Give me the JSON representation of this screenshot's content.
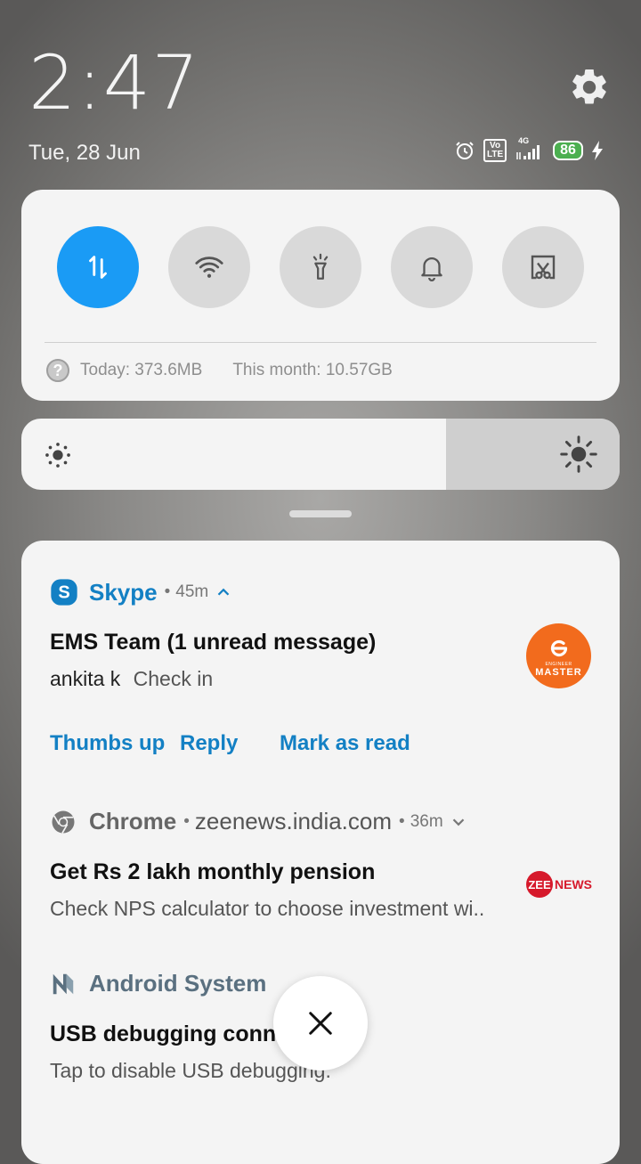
{
  "header": {
    "time": "2:47",
    "date": "Tue, 28 Jun",
    "battery_level": "86",
    "network": "4G",
    "volte_label_top": "Vo",
    "volte_label_bottom": "LTE"
  },
  "quick_settings": {
    "tiles": [
      {
        "name": "mobile-data",
        "icon": "data-arrows-icon",
        "active": true
      },
      {
        "name": "wifi",
        "icon": "wifi-icon",
        "active": false
      },
      {
        "name": "flashlight",
        "icon": "flashlight-icon",
        "active": false
      },
      {
        "name": "sound",
        "icon": "bell-icon",
        "active": false
      },
      {
        "name": "screenshot",
        "icon": "scissors-screen-icon",
        "active": false
      }
    ],
    "usage_today": "Today: 373.6MB",
    "usage_month": "This month: 10.57GB"
  },
  "brightness": {
    "level": 0.71
  },
  "notifications": {
    "skype": {
      "app": "Skype",
      "time": "45m",
      "title": "EMS Team (1 unread message)",
      "sender": "ankita k",
      "message": "Check in",
      "actions": [
        "Thumbs up",
        "Reply",
        "Mark as read"
      ],
      "logo_top": "ENGINEER",
      "logo_bottom": "MASTER"
    },
    "chrome": {
      "app": "Chrome",
      "source": "zeenews.india.com",
      "time": "36m",
      "title": "Get Rs 2 lakh monthly pension",
      "body": "Check NPS calculator to choose investment wi..",
      "logo_a": "ZEE",
      "logo_b": "NEWS"
    },
    "android": {
      "app": "Android System",
      "title": "USB debugging conn",
      "body": "Tap to disable USB debugging."
    }
  },
  "colors": {
    "accent": "#1a9bf5",
    "skype": "#1380c4",
    "ems_orange": "#f26b1d",
    "zee_red": "#d6192b"
  }
}
